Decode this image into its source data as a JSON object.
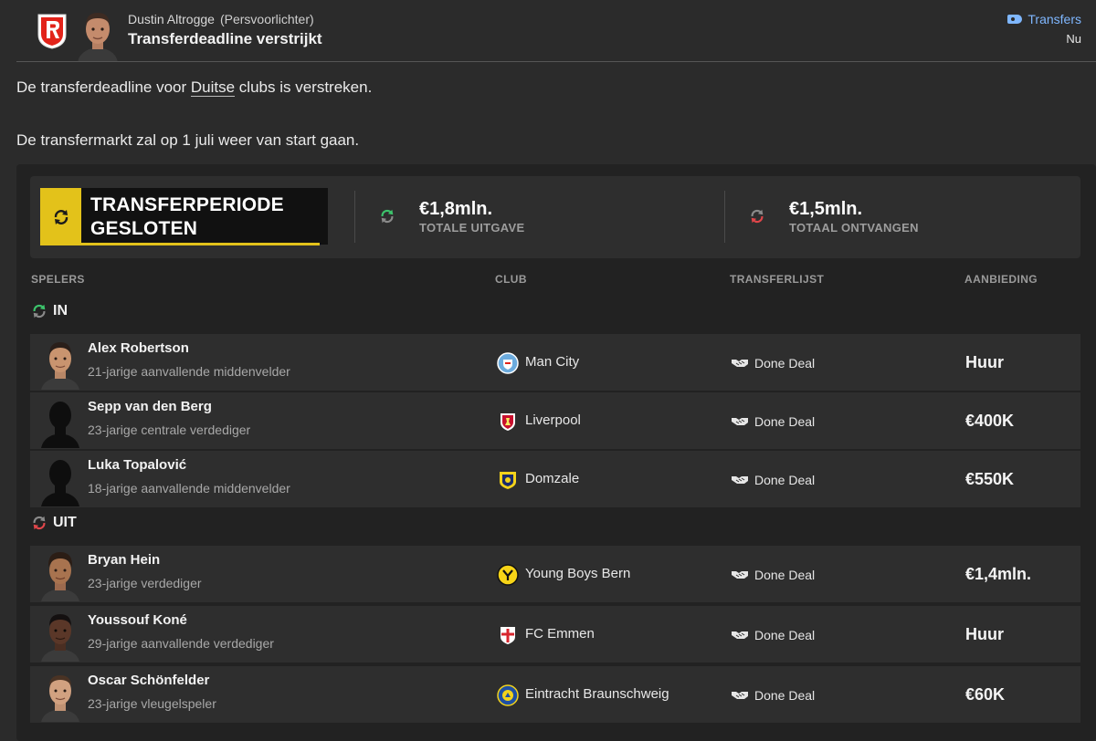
{
  "message": {
    "author_name": "Dustin Altrogge",
    "author_role": "(Persvoorlichter)",
    "title": "Transferdeadline verstrijkt",
    "tag": "Transfers",
    "time": "Nu",
    "para1_before": "De transferdeadline voor ",
    "para1_link": "Duitse",
    "para1_after": " clubs is verstreken.",
    "para2": "De transfermarkt zal op 1 juli weer van start gaan."
  },
  "summary": {
    "status_line1": "TRANSFERPERIODE",
    "status_line2": "GESLOTEN",
    "spent_value": "€1,8mln.",
    "spent_label": "TOTALE UITGAVE",
    "received_value": "€1,5mln.",
    "received_label": "TOTAAL ONTVANGEN"
  },
  "columns": {
    "players": "SPELERS",
    "club": "CLUB",
    "transferlist": "TRANSFERLIJST",
    "offer": "AANBIEDING"
  },
  "sections": {
    "in": "IN",
    "out": "UIT"
  },
  "in_rows": [
    {
      "name": "Alex Robertson",
      "desc": "21-jarige aanvallende middenvelder",
      "club": "Man City",
      "status": "Done Deal",
      "offer": "Huur"
    },
    {
      "name": "Sepp van den Berg",
      "desc": "23-jarige centrale verdediger",
      "club": "Liverpool",
      "status": "Done Deal",
      "offer": "€400K"
    },
    {
      "name": "Luka Topalović",
      "desc": "18-jarige aanvallende middenvelder",
      "club": "Domzale",
      "status": "Done Deal",
      "offer": "€550K"
    }
  ],
  "out_rows": [
    {
      "name": "Bryan Hein",
      "desc": "23-jarige verdediger",
      "club": "Young Boys Bern",
      "status": "Done Deal",
      "offer": "€1,4mln."
    },
    {
      "name": "Youssouf Koné",
      "desc": "29-jarige aanvallende verdediger",
      "club": "FC Emmen",
      "status": "Done Deal",
      "offer": "Huur"
    },
    {
      "name": "Oscar Schönfelder",
      "desc": "23-jarige vleugelspeler",
      "club": "Eintracht Braunschweig",
      "status": "Done Deal",
      "offer": "€60K"
    }
  ],
  "colors": {
    "accent_yellow": "#e3c21a",
    "in_green": "#3cc36b",
    "out_red": "#e0464a",
    "tag_blue": "#7fb7ff"
  }
}
